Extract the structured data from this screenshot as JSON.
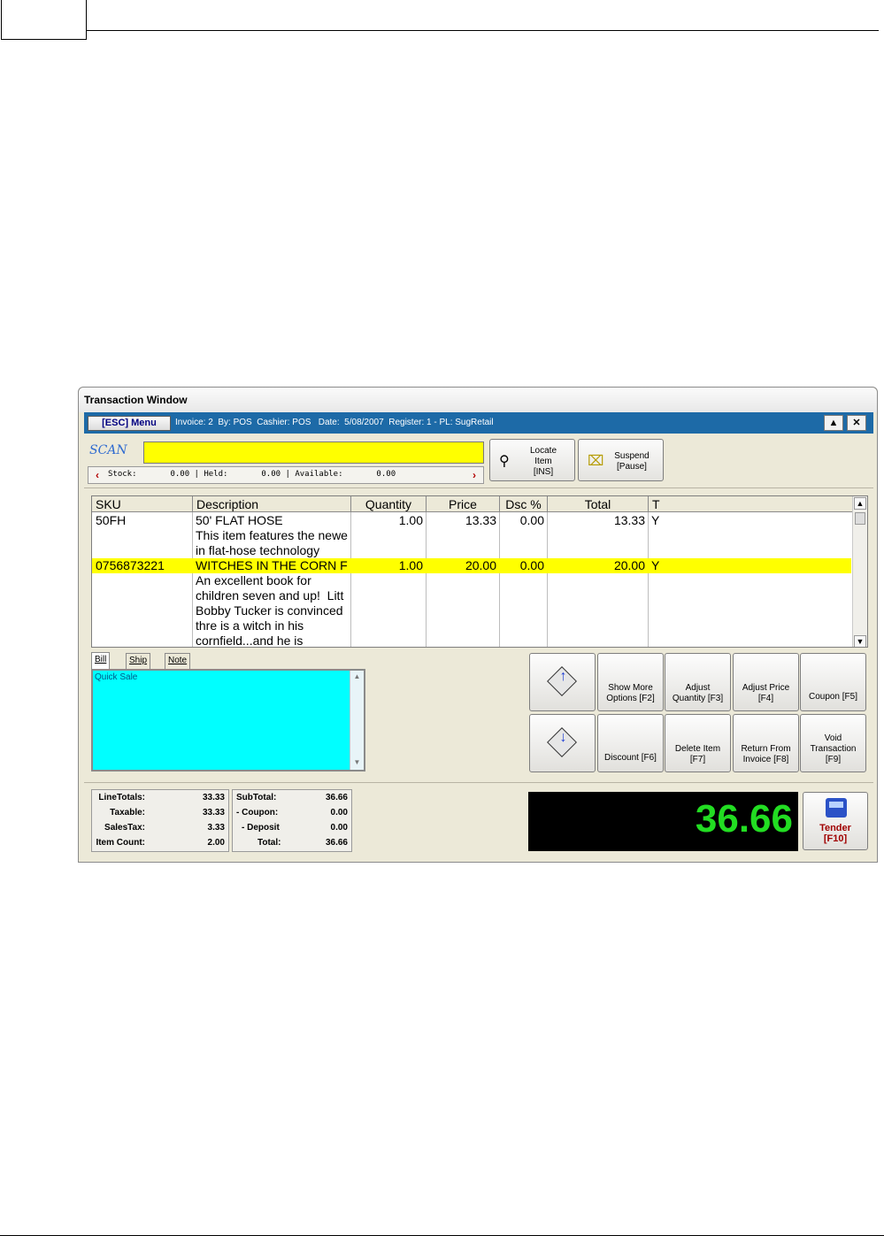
{
  "window": {
    "title": "Transaction Window"
  },
  "menubar": {
    "esc_label": "[ESC] Menu",
    "info": "Invoice: 2  By: POS  Cashier: POS   Date:  5/08/2007  Register: 1 - PL: SugRetail",
    "up_icon": "▲",
    "close_icon": "✕"
  },
  "scan": {
    "label": "SCAN",
    "input_value": "",
    "stock_text": "Stock:       0.00 | Held:       0.00 | Available:       0.00"
  },
  "toolbar": {
    "locate_label": "Locate\nItem\n[INS]",
    "suspend_label": "Suspend\n[Pause]"
  },
  "grid": {
    "columns": [
      "SKU",
      "Description",
      "Quantity",
      "Price",
      "Dsc %",
      "Total",
      "T"
    ],
    "rows": [
      {
        "sku": "50FH",
        "description": "50' FLAT HOSE",
        "description_more": "This item features the newe\nin flat-hose technology",
        "quantity": "1.00",
        "price": "13.33",
        "discount": "0.00",
        "total": "13.33",
        "taxable": "Y"
      },
      {
        "sku": "0756873221",
        "description": "WITCHES IN THE CORN F",
        "description_more": "An excellent book for\nchildren seven and up!  Litt\nBobby Tucker is convinced\nthre is a witch in his\ncornfield...and he is",
        "quantity": "1.00",
        "price": "20.00",
        "discount": "0.00",
        "total": "20.00",
        "taxable": "Y"
      }
    ]
  },
  "tabs": [
    "Bill To",
    "Ship To",
    "Note"
  ],
  "note": {
    "text": "Quick Sale"
  },
  "actions": {
    "show_more": "Show More\nOptions [F2]",
    "adjust_qty": "Adjust\nQuantity [F3]",
    "adjust_price": "Adjust Price\n[F4]",
    "coupon": "Coupon [F5]",
    "discount": "Discount [F6]",
    "delete_item": "Delete Item\n[F7]",
    "return_invoice": "Return From\nInvoice [F8]",
    "void": "Void\nTransaction\n[F9]"
  },
  "totals": {
    "line_totals_label": "LineTotals:",
    "line_totals": "33.33",
    "taxable_label": "Taxable:",
    "taxable": "33.33",
    "sales_tax_label": "SalesTax:",
    "sales_tax": "3.33",
    "item_count_label": "Item Count:",
    "item_count": "2.00",
    "subtotal_label": "SubTotal:",
    "subtotal": "36.66",
    "coupon_label": "- Coupon:",
    "coupon": "0.00",
    "deposit_label": "- Deposit",
    "deposit": "0.00",
    "total_label": "Total:",
    "total": "36.66"
  },
  "display": {
    "amount": "36.66"
  },
  "tender": {
    "label": "Tender",
    "key": "[F10]"
  },
  "colors": {
    "accent": "#1d6aa7",
    "scan_bg": "#ffff00",
    "note_bg": "#00ffff",
    "display_fg": "#22dd22"
  }
}
